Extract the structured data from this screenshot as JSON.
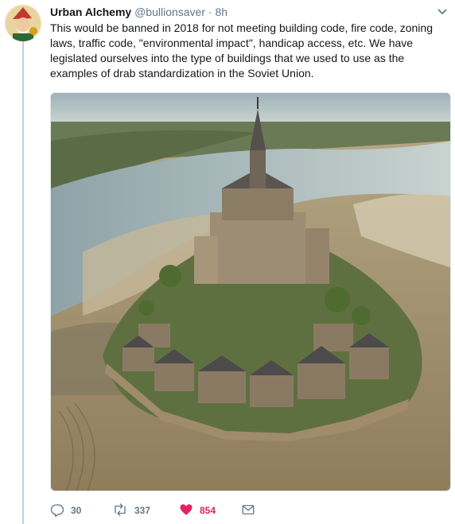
{
  "tweet": {
    "author_name": "Urban Alchemy",
    "handle": "@bullionsaver",
    "separator": "·",
    "time": "8h",
    "text": "This would be banned in 2018 for not meeting building code, fire code, zoning laws, traffic code, \"environmental impact\", handicap access, etc. We have legislated ourselves into the type of buildings that we used to use as the examples of drab standardization in the Soviet Union."
  },
  "actions": {
    "reply": {
      "icon": "reply-icon",
      "count": "30"
    },
    "retweet": {
      "icon": "retweet-icon",
      "count": "337"
    },
    "like": {
      "icon": "heart-icon",
      "count": "854",
      "liked": true
    },
    "message": {
      "icon": "envelope-icon"
    }
  },
  "colors": {
    "text": "#14171a",
    "muted": "#657786",
    "like": "#e0245e",
    "thread_line": "#c4cfd6"
  }
}
